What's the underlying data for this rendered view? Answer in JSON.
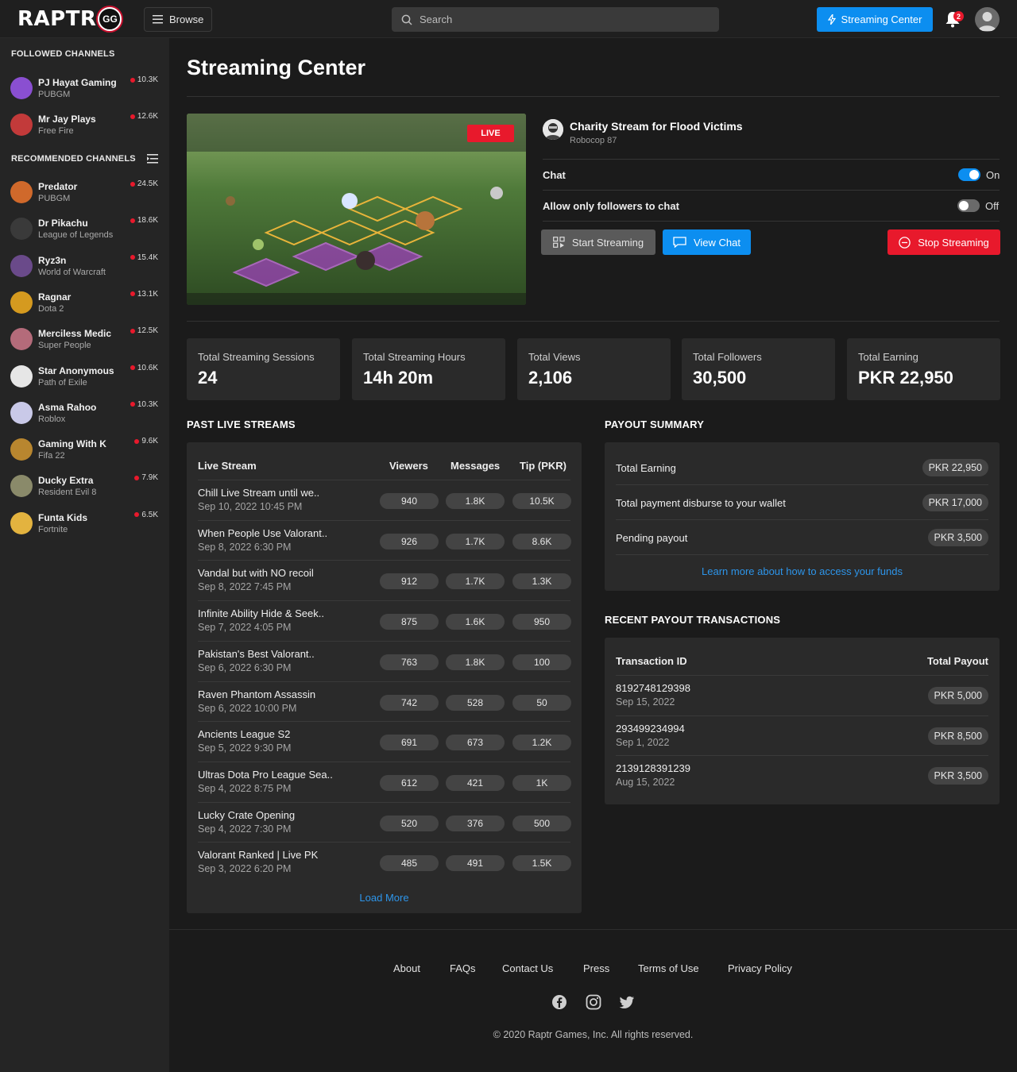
{
  "header": {
    "logo_text": "RAPTR",
    "logo_badge": "GG",
    "browse_label": "Browse",
    "search_placeholder": "Search",
    "streaming_center_label": "Streaming Center",
    "notification_count": "2"
  },
  "sidebar": {
    "followed_heading": "FOLLOWED CHANNELS",
    "recommended_heading": "RECOMMENDED CHANNELS",
    "followed": [
      {
        "name": "PJ Hayat Gaming",
        "game": "PUBGM",
        "count": "10.3K",
        "color": "#8a4fd1"
      },
      {
        "name": "Mr Jay Plays",
        "game": "Free Fire",
        "count": "12.6K",
        "color": "#c23a3a"
      }
    ],
    "recommended": [
      {
        "name": "Predator",
        "game": "PUBGM",
        "count": "24.5K",
        "color": "#d0692b"
      },
      {
        "name": "Dr Pikachu",
        "game": "League of Legends",
        "count": "18.6K",
        "color": "#3a3a3a"
      },
      {
        "name": "Ryz3n",
        "game": "World of Warcraft",
        "count": "15.4K",
        "color": "#6a4a8a"
      },
      {
        "name": "Ragnar",
        "game": "Dota 2",
        "count": "13.1K",
        "color": "#d59a1f"
      },
      {
        "name": "Merciless Medic",
        "game": "Super People",
        "count": "12.5K",
        "color": "#b46b7a"
      },
      {
        "name": "Star Anonymous",
        "game": "Path of Exile",
        "count": "10.6K",
        "color": "#e6e6e6"
      },
      {
        "name": "Asma Rahoo",
        "game": "Roblox",
        "count": "10.3K",
        "color": "#c9c9e8"
      },
      {
        "name": "Gaming With K",
        "game": "Fifa 22",
        "count": "9.6K",
        "color": "#b8862f"
      },
      {
        "name": "Ducky Extra",
        "game": "Resident Evil 8",
        "count": "7.9K",
        "color": "#8a8a6a"
      },
      {
        "name": "Funta Kids",
        "game": "Fortnite",
        "count": "6.5K",
        "color": "#e3b33f"
      }
    ]
  },
  "page": {
    "title": "Streaming Center",
    "live_badge": "LIVE",
    "stream_title": "Charity Stream for Flood Victims",
    "stream_user": "Robocop 87",
    "chat_label": "Chat",
    "chat_state": "On",
    "followers_label": "Allow only followers to chat",
    "followers_state": "Off",
    "start_label": "Start Streaming",
    "view_chat_label": "View Chat",
    "stop_label": "Stop Streaming"
  },
  "stats": [
    {
      "label": "Total Streaming Sessions",
      "value": "24"
    },
    {
      "label": "Total Streaming Hours",
      "value": "14h 20m"
    },
    {
      "label": "Total Views",
      "value": "2,106"
    },
    {
      "label": "Total Followers",
      "value": "30,500"
    },
    {
      "label": "Total Earning",
      "value": "PKR 22,950"
    }
  ],
  "past": {
    "heading": "PAST LIVE STREAMS",
    "columns": [
      "Live Stream",
      "Viewers",
      "Messages",
      "Tip (PKR)"
    ],
    "rows": [
      {
        "title": "Chill Live Stream until we..",
        "date": "Sep 10, 2022 10:45 PM",
        "viewers": "940",
        "messages": "1.8K",
        "tip": "10.5K"
      },
      {
        "title": "When People Use Valorant..",
        "date": "Sep 8, 2022 6:30 PM",
        "viewers": "926",
        "messages": "1.7K",
        "tip": "8.6K"
      },
      {
        "title": "Vandal but with NO recoil",
        "date": "Sep 8, 2022 7:45 PM",
        "viewers": "912",
        "messages": "1.7K",
        "tip": "1.3K"
      },
      {
        "title": "Infinite Ability Hide & Seek..",
        "date": "Sep 7, 2022 4:05 PM",
        "viewers": "875",
        "messages": "1.6K",
        "tip": "950"
      },
      {
        "title": "Pakistan's Best Valorant..",
        "date": "Sep 6, 2022 6:30 PM",
        "viewers": "763",
        "messages": "1.8K",
        "tip": "100"
      },
      {
        "title": "Raven Phantom Assassin",
        "date": "Sep 6, 2022 10:00 PM",
        "viewers": "742",
        "messages": "528",
        "tip": "50"
      },
      {
        "title": "Ancients League S2",
        "date": "Sep 5, 2022 9:30 PM",
        "viewers": "691",
        "messages": "673",
        "tip": "1.2K"
      },
      {
        "title": "Ultras Dota Pro League Sea..",
        "date": "Sep 4, 2022 8:75 PM",
        "viewers": "612",
        "messages": "421",
        "tip": "1K"
      },
      {
        "title": "Lucky Crate Opening",
        "date": "Sep 4, 2022 7:30 PM",
        "viewers": "520",
        "messages": "376",
        "tip": "500"
      },
      {
        "title": "Valorant Ranked | Live PK",
        "date": "Sep 3, 2022 6:20 PM",
        "viewers": "485",
        "messages": "491",
        "tip": "1.5K"
      }
    ],
    "load_more": "Load More"
  },
  "payout": {
    "heading": "PAYOUT SUMMARY",
    "rows": [
      {
        "label": "Total Earning",
        "value": "PKR 22,950"
      },
      {
        "label": "Total payment disburse to your wallet",
        "value": "PKR 17,000"
      },
      {
        "label": "Pending payout",
        "value": "PKR 3,500"
      }
    ],
    "link": "Learn more about how to access your funds"
  },
  "transactions": {
    "heading": "RECENT PAYOUT TRANSACTIONS",
    "col_id": "Transaction ID",
    "col_total": "Total Payout",
    "rows": [
      {
        "id": "8192748129398",
        "date": "Sep 15, 2022",
        "amount": "PKR 5,000"
      },
      {
        "id": "293499234994",
        "date": "Sep 1, 2022",
        "amount": "PKR 8,500"
      },
      {
        "id": "2139128391239",
        "date": "Aug 15, 2022",
        "amount": "PKR 3,500"
      }
    ]
  },
  "footer": {
    "links": [
      "About",
      "FAQs",
      "Contact Us",
      "Press",
      "Terms of Use",
      "Privacy Policy"
    ],
    "social_icons": [
      "facebook-icon",
      "instagram-icon",
      "twitter-icon"
    ],
    "copyright": "© 2020 Raptr Games, Inc. All rights reserved."
  },
  "colors": {
    "accent": "#0c8ef0",
    "danger": "#e8192c",
    "toggle_on": "#0c8ef0",
    "toggle_off": "#6a6a6a"
  }
}
